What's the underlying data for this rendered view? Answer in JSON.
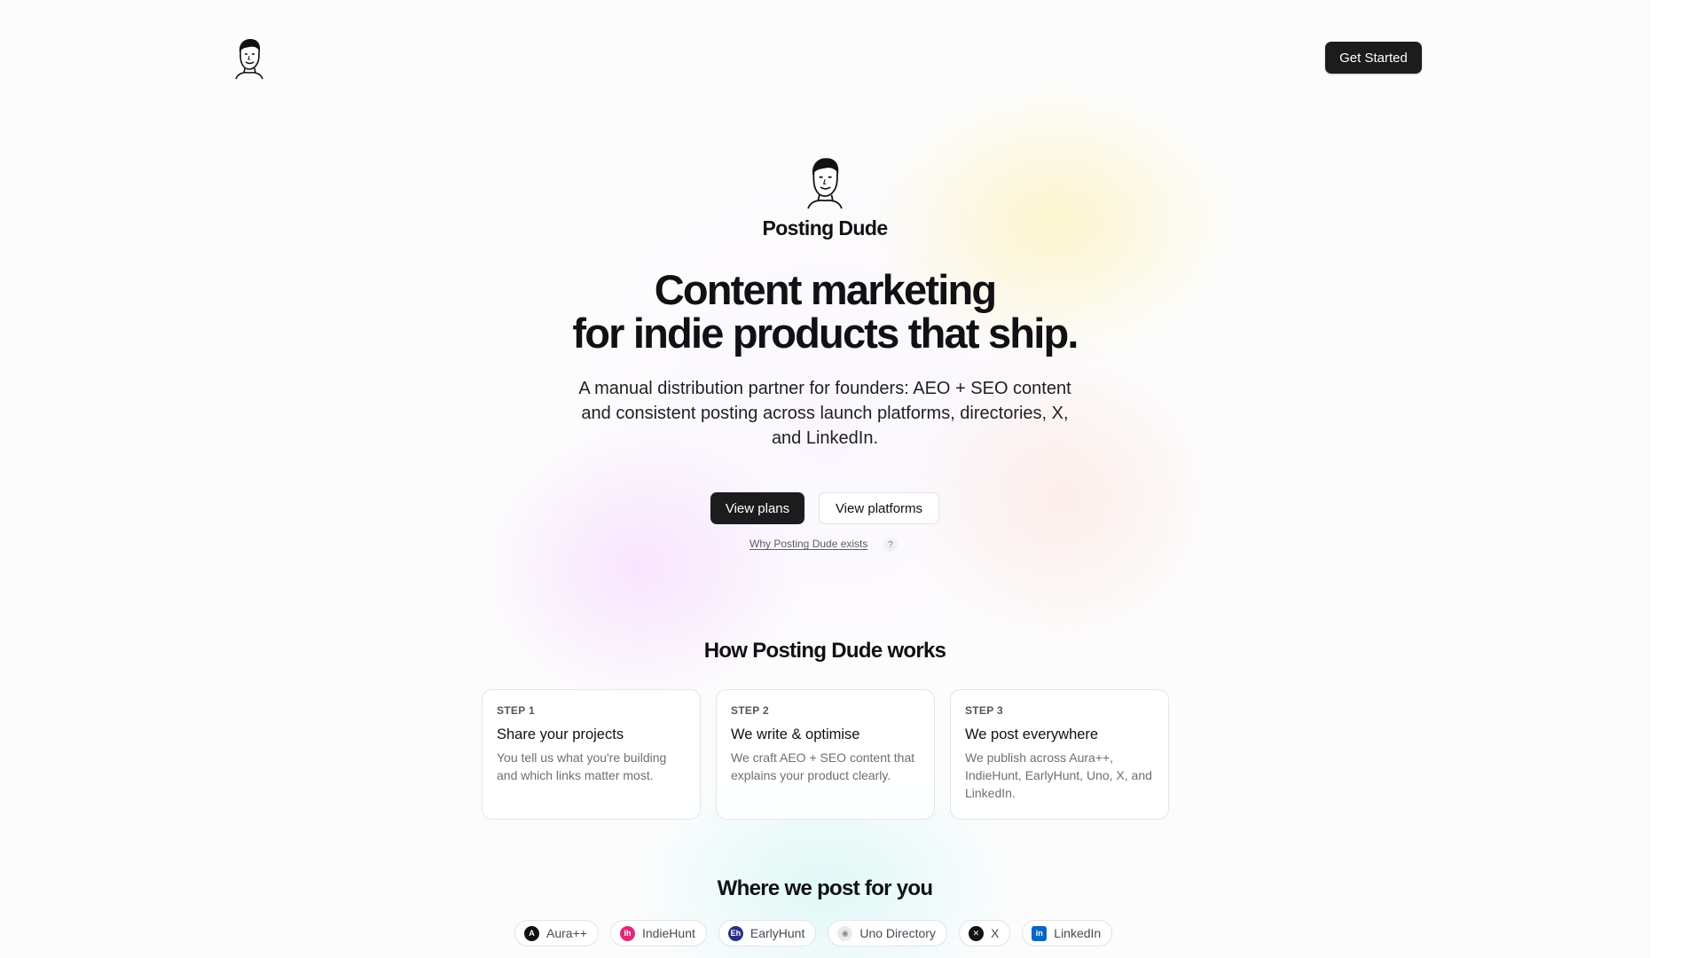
{
  "header": {
    "logo_icon": "dude-face-icon",
    "cta_label": "Get Started"
  },
  "hero": {
    "logo_icon": "dude-face-icon",
    "brand": "Posting Dude",
    "headline_line1": "Content marketing",
    "headline_line2": "for indie products that ship.",
    "subhead": "A manual distribution partner for founders: AEO + SEO content and consistent posting across launch platforms, directories, X, and LinkedIn.",
    "primary_button": "View plans",
    "secondary_button": "View platforms",
    "why_link": "Why Posting Dude exists",
    "why_help": "?"
  },
  "how": {
    "title": "How Posting Dude works",
    "steps": [
      {
        "label": "STEP 1",
        "title": "Share your projects",
        "desc": "You tell us what you're building and which links matter most."
      },
      {
        "label": "STEP 2",
        "title": "We write & optimise",
        "desc": "We craft AEO + SEO content that explains your product clearly."
      },
      {
        "label": "STEP 3",
        "title": "We post everywhere",
        "desc": "We publish across Aura++, IndieHunt, EarlyHunt, Uno, X, and LinkedIn."
      }
    ]
  },
  "where": {
    "title": "Where we post for you",
    "platforms": [
      {
        "name": "Aura++",
        "icon": "aura-icon",
        "glyph": "A",
        "color": "#111111"
      },
      {
        "name": "IndieHunt",
        "icon": "indiehunt-icon",
        "glyph": "ih",
        "color": "#e0287a"
      },
      {
        "name": "EarlyHunt",
        "icon": "earlyhunt-icon",
        "glyph": "Eh",
        "color": "#2a2f86"
      },
      {
        "name": "Uno Directory",
        "icon": "uno-directory-icon",
        "glyph": "◉",
        "color": "#d8d8de"
      },
      {
        "name": "X",
        "icon": "x-logo-icon",
        "glyph": "✕",
        "color": "#111111"
      },
      {
        "name": "LinkedIn",
        "icon": "linkedin-icon",
        "glyph": "in",
        "color": "#0a66c2"
      }
    ]
  }
}
